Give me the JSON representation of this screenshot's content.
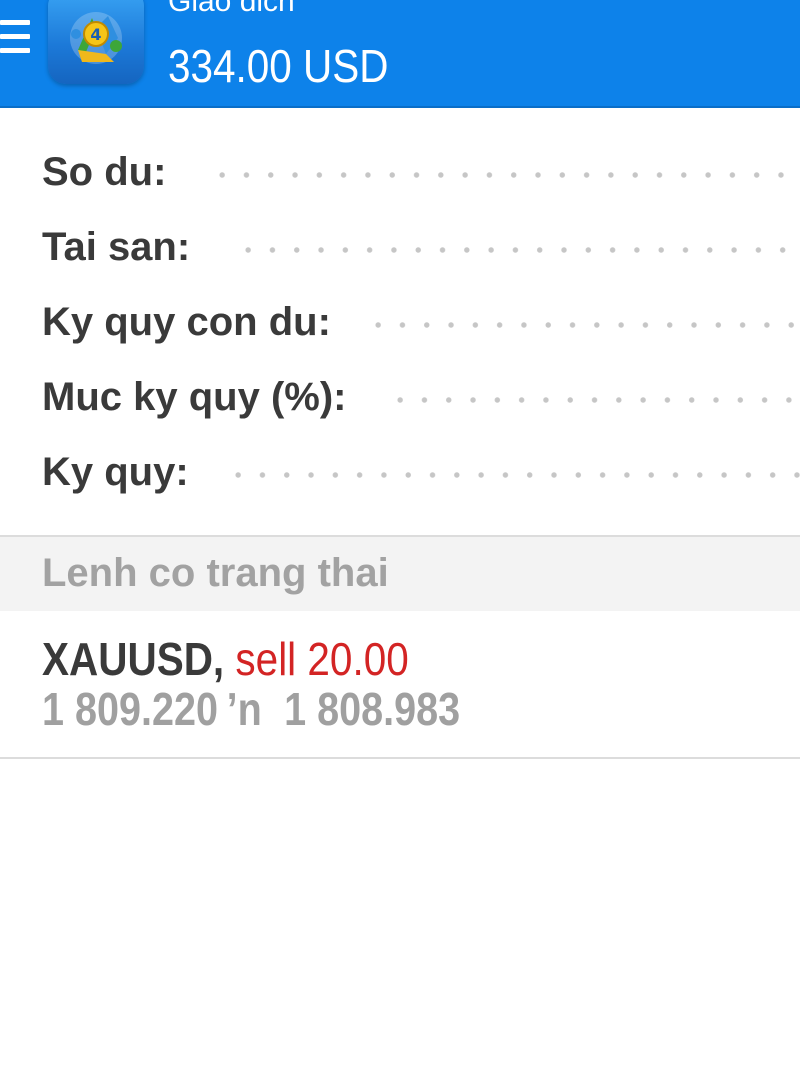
{
  "header": {
    "title": "Giao dich",
    "balance": "334.00 USD",
    "menu_icon": "hamburger-menu-icon",
    "logo_icon": "metatrader-4-logo-icon",
    "colors": {
      "bar": "#0d82ea",
      "text": "#ffffff"
    }
  },
  "summary": {
    "rows": [
      {
        "label": "So du:"
      },
      {
        "label": "Tai san:"
      },
      {
        "label": "Ky quy con du:"
      },
      {
        "label": "Muc ky quy (%):"
      },
      {
        "label": "Ky quy:"
      }
    ]
  },
  "positions_section": {
    "header": "Lenh co trang thai"
  },
  "orders": [
    {
      "symbol": "XAUUSD,",
      "side": "sell 20.00",
      "open_price": "1 809.220",
      "separator": "’n",
      "current_price": "1 808.983",
      "colors": {
        "side": "#d32424",
        "prices": "#a0a0a0"
      }
    }
  ]
}
